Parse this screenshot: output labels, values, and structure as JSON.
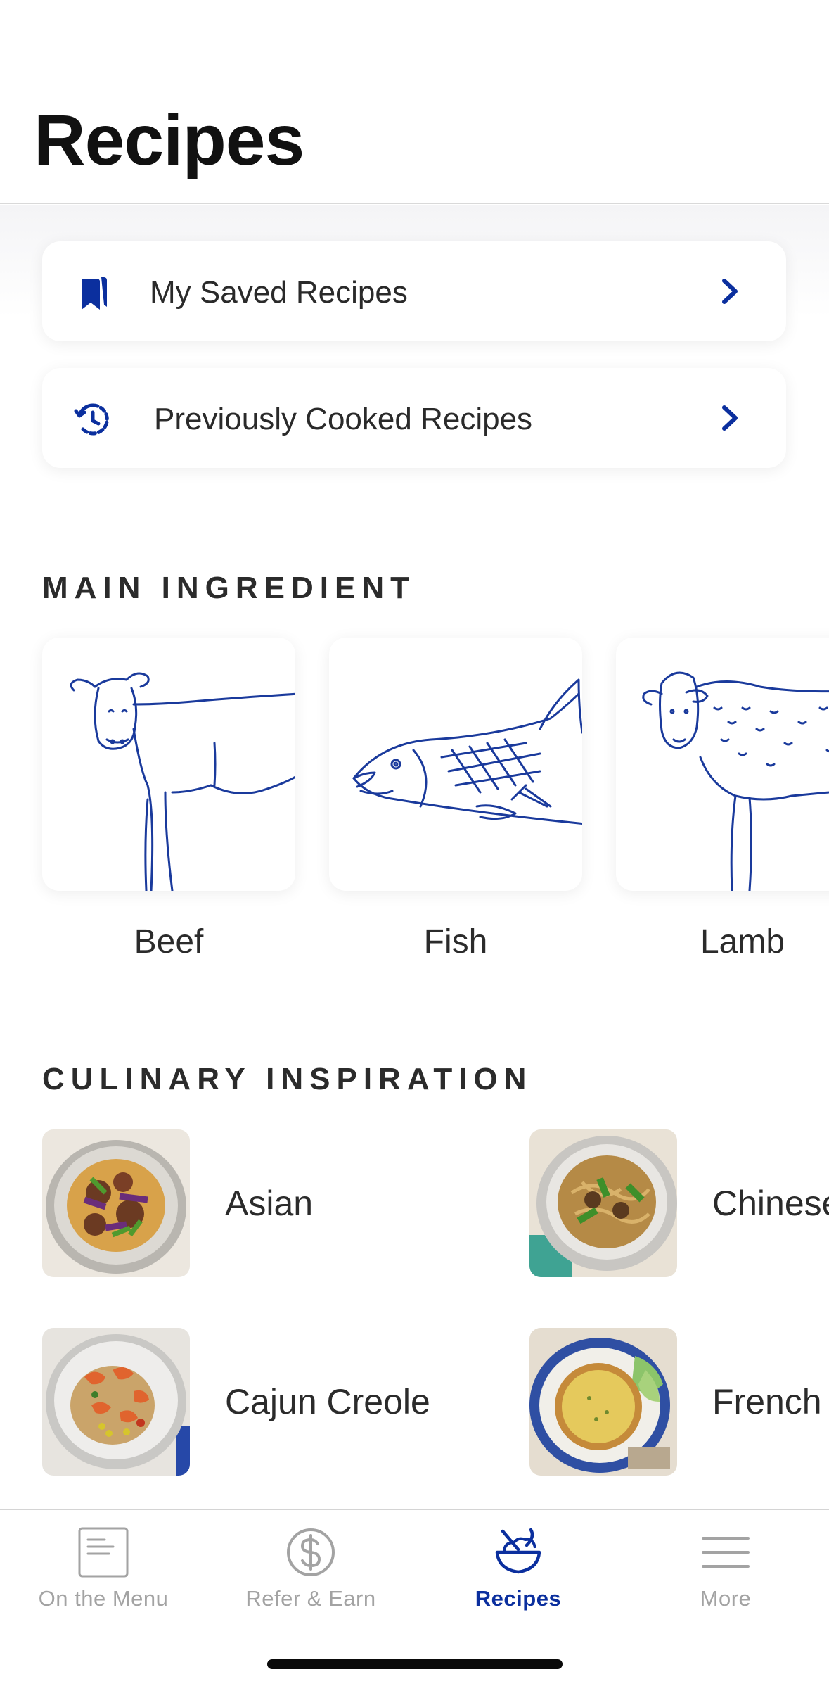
{
  "header": {
    "title": "Recipes"
  },
  "links": [
    {
      "label": "My Saved Recipes",
      "icon": "bookmark-icon"
    },
    {
      "label": "Previously Cooked Recipes",
      "icon": "history-clock-icon"
    }
  ],
  "main_ingredient": {
    "heading": "MAIN INGREDIENT",
    "items": [
      {
        "label": "Beef",
        "icon": "cow-illustration"
      },
      {
        "label": "Fish",
        "icon": "salmon-illustration"
      },
      {
        "label": "Lamb",
        "icon": "sheep-illustration"
      }
    ]
  },
  "culinary_inspiration": {
    "heading": "CULINARY INSPIRATION",
    "items": [
      {
        "label": "Asian"
      },
      {
        "label": "Chinese"
      },
      {
        "label": "Cajun Creole"
      },
      {
        "label": "French"
      }
    ]
  },
  "tabbar": {
    "tabs": [
      {
        "label": "On the Menu",
        "icon": "menu-card-icon",
        "active": false
      },
      {
        "label": "Refer & Earn",
        "icon": "dollar-circle-icon",
        "active": false
      },
      {
        "label": "Recipes",
        "icon": "bowl-icon",
        "active": true
      },
      {
        "label": "More",
        "icon": "hamburger-icon",
        "active": false
      }
    ]
  },
  "colors": {
    "accent": "#0b2f9e",
    "illustration": "#1a3a9c",
    "inactive": "#a3a3a3"
  }
}
